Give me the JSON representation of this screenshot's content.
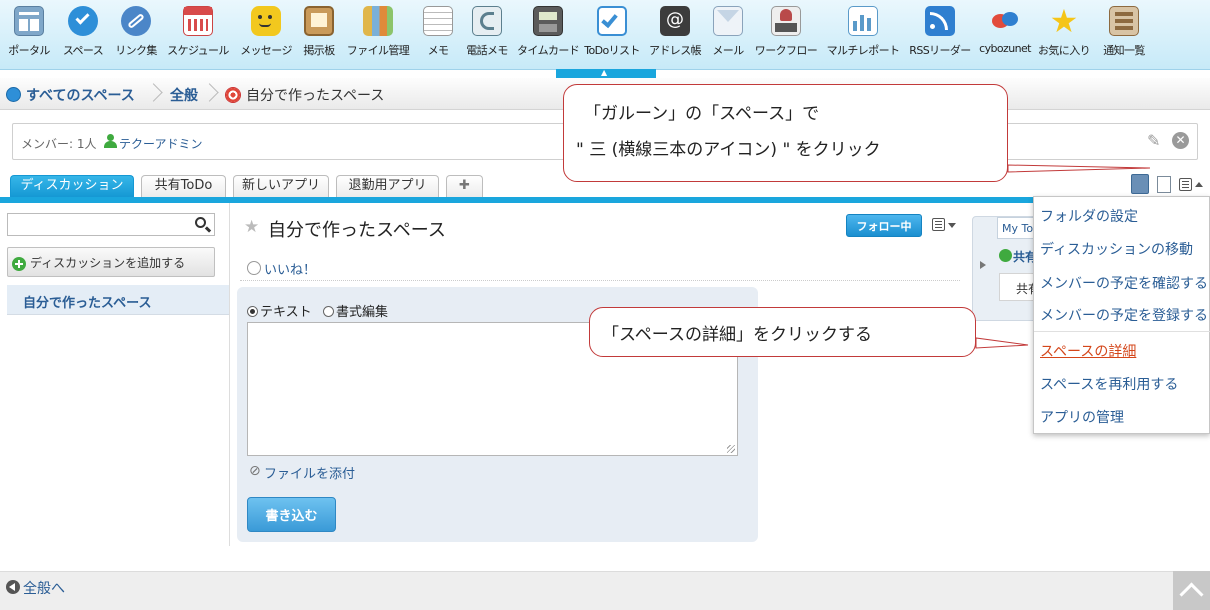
{
  "app_menu": [
    {
      "label": "ポータル",
      "icon": "portal-icon",
      "color": "#7fa7c9"
    },
    {
      "label": "スペース",
      "icon": "space-icon",
      "color": "#2e8fd8"
    },
    {
      "label": "リンク集",
      "icon": "link-icon",
      "color": "#4b86c8"
    },
    {
      "label": "スケジュール",
      "icon": "calendar-icon",
      "color": "#d84b4b"
    },
    {
      "label": "メッセージ",
      "icon": "message-icon",
      "color": "#f2c81e"
    },
    {
      "label": "掲示板",
      "icon": "bulletin-board-icon",
      "color": "#c99a5a"
    },
    {
      "label": "ファイル管理",
      "icon": "file-icon",
      "color": "#e0b64a"
    },
    {
      "label": "メモ",
      "icon": "memo-icon",
      "color": "#d9d9d9"
    },
    {
      "label": "電話メモ",
      "icon": "phone-icon",
      "color": "#5c7f8e"
    },
    {
      "label": "タイムカード",
      "icon": "timecard-icon",
      "color": "#5b5b5b"
    },
    {
      "label": "ToDoリスト",
      "icon": "todo-icon",
      "color": "#3a8fd4"
    },
    {
      "label": "アドレス帳",
      "icon": "address-book-icon",
      "color": "#3c3c3c"
    },
    {
      "label": "メール",
      "icon": "mail-icon",
      "color": "#dbe6ef"
    },
    {
      "label": "ワークフロー",
      "icon": "workflow-icon",
      "color": "#b94a4a"
    },
    {
      "label": "マルチレポート",
      "icon": "report-icon",
      "color": "#5a9ac9"
    },
    {
      "label": "RSSリーダー",
      "icon": "rss-icon",
      "color": "#2f7fd0"
    },
    {
      "label": "cybozunet",
      "icon": "cybozu-icon",
      "color": "#e24b3c"
    },
    {
      "label": "お気に入り",
      "icon": "star-icon",
      "color": "#f5c518"
    },
    {
      "label": "通知一覧",
      "icon": "notification-icon",
      "color": "#b58b5c"
    }
  ],
  "breadcrumb": {
    "all_spaces": "すべてのスペース",
    "general": "全般",
    "current": "自分で作ったスペース"
  },
  "members": {
    "label": "メンバー: 1人",
    "user": "テクーアドミン"
  },
  "tabs": [
    "ディスカッション",
    "共有ToDo",
    "新しいアプリ",
    "退勤用アプリ",
    "✚"
  ],
  "left": {
    "search_value": "",
    "add_discussion": "ディスカッションを追加する",
    "folder": "自分で作ったスペース"
  },
  "main": {
    "title": "自分で作ったスペース",
    "follow": "フォロー中",
    "like": "いいね！",
    "radio_text": "テキスト",
    "radio_rich": "書式編集",
    "attach": "ファイルを添付",
    "submit": "書き込む"
  },
  "side_panel": {
    "tab": "My To",
    "add": "共有",
    "box": "共有"
  },
  "dropdown": [
    "フォルダの設定",
    "ディスカッションの移動",
    "メンバーの予定を確認する",
    "メンバーの予定を登録する",
    "スペースの詳細",
    "スペースを再利用する",
    "アプリの管理"
  ],
  "footer": {
    "back": "全般へ"
  },
  "callouts": {
    "c1_line1": "「ガルーン」の「スペース」で",
    "c1_line2": "\" 三 (横線三本のアイコン) \" をクリック",
    "c2": "「スペースの詳細」をクリックする"
  },
  "colors": {
    "accent": "#1aa6dd",
    "link": "#2a5d95",
    "highlight": "#d4461a",
    "callout_border": "#c23a3a"
  }
}
